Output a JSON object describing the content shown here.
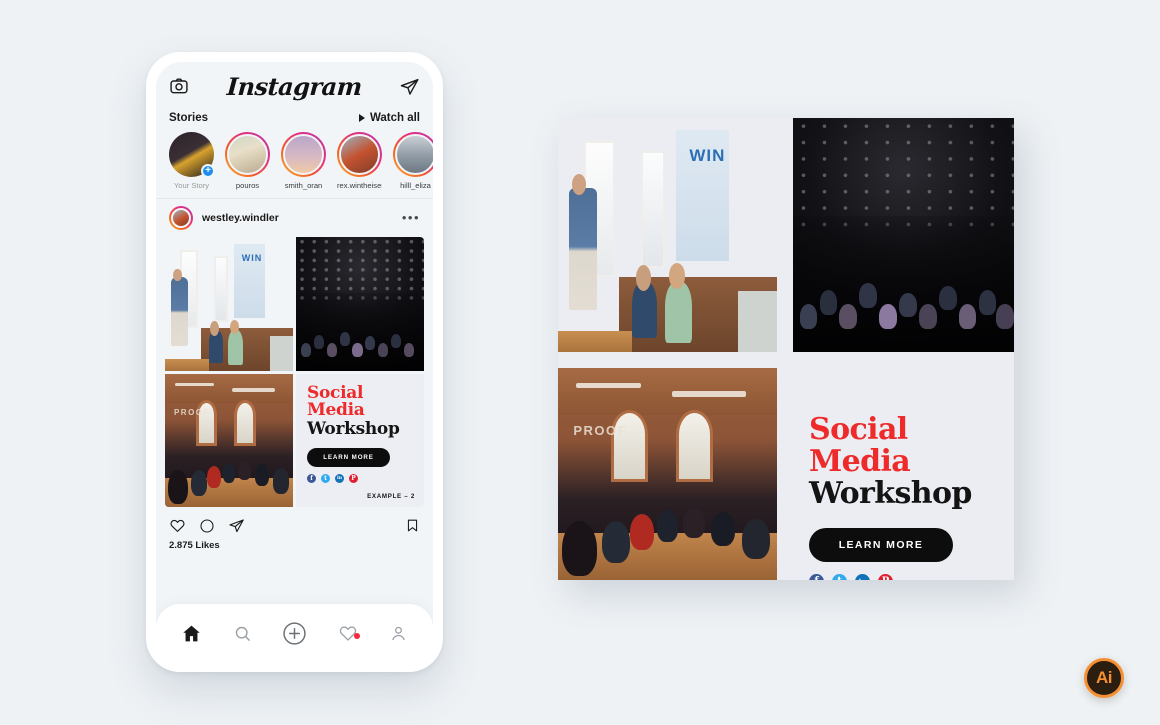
{
  "background_color": "#eef2f5",
  "phone": {
    "header": {
      "camera_icon": "camera-icon",
      "logo_text": "Instagram",
      "messenger_icon": "paper-plane-icon"
    },
    "stories": {
      "title": "Stories",
      "watch_all": "Watch all",
      "items": [
        {
          "name": "Your Story",
          "has_ring": false,
          "has_plus": true,
          "plus": "+"
        },
        {
          "name": "pouros",
          "has_ring": true,
          "has_plus": false
        },
        {
          "name": "smith_oran",
          "has_ring": true,
          "has_plus": false
        },
        {
          "name": "rex.wintheiser",
          "has_ring": true,
          "has_plus": false
        },
        {
          "name": "hilll_eliza",
          "has_ring": true,
          "has_plus": false
        }
      ]
    },
    "post": {
      "username": "westley.windler",
      "more_label": "•••",
      "likes": "2.875 Likes"
    },
    "tabbar": {
      "items": [
        "home-icon",
        "search-icon",
        "add-post-icon",
        "activity-icon",
        "profile-icon"
      ]
    }
  },
  "creative": {
    "headline_red": "Social Media",
    "headline_black": "Workshop",
    "cta_label": "LEARN MORE",
    "example_label": "EXAMPLE – 2",
    "socials": [
      {
        "name": "facebook-icon",
        "glyph": "f",
        "color": "#3b5998"
      },
      {
        "name": "twitter-icon",
        "glyph": "t",
        "color": "#32aaf0"
      },
      {
        "name": "linkedin-icon",
        "glyph": "in",
        "color": "#1172b8"
      },
      {
        "name": "pinterest-icon",
        "glyph": "P",
        "color": "#e02030"
      }
    ],
    "photos": [
      {
        "name": "speaker-brick-loft-photo",
        "sign_text": "WIN"
      },
      {
        "name": "dark-auditorium-crowd-photo"
      },
      {
        "name": "brick-hall-audience-photo",
        "sign_text": "PROOF"
      }
    ],
    "colors": {
      "headline_red": "#ee2a2a",
      "cta_bg": "#0d0d0d",
      "card_bg": "#ebedf2"
    }
  },
  "badge": {
    "label": "Ai",
    "ring_color": "#f59032",
    "fill_color": "#2b1d10"
  }
}
